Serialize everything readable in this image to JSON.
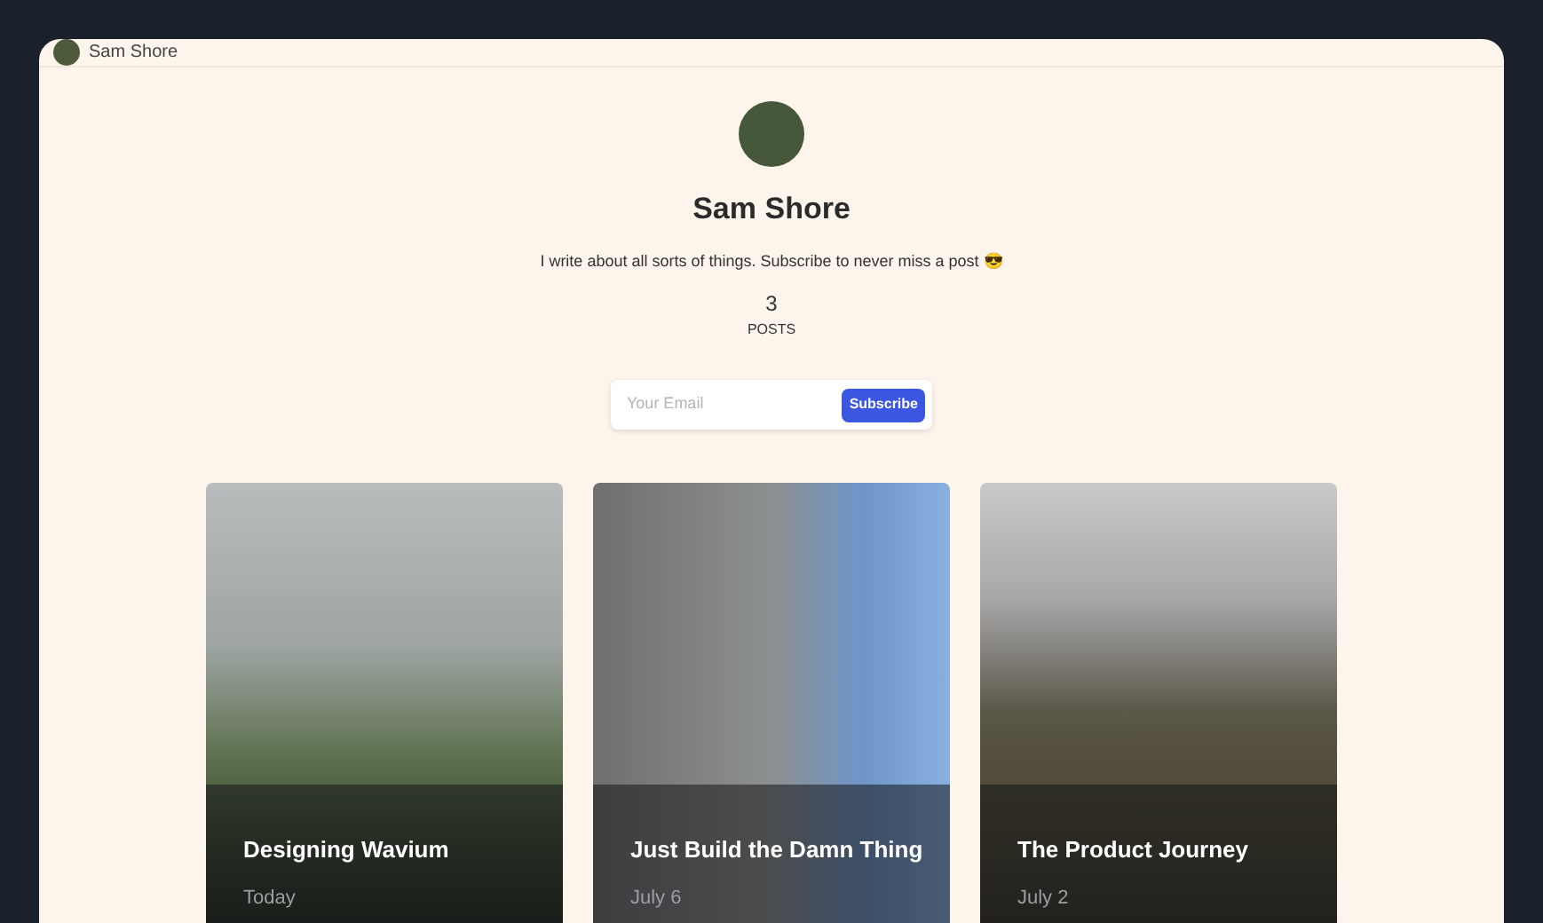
{
  "header": {
    "name": "Sam Shore"
  },
  "profile": {
    "name": "Sam Shore",
    "bio": "I write about all sorts of things. Subscribe to never miss a post 😎",
    "post_count": "3",
    "post_label": "POSTS"
  },
  "subscribe": {
    "placeholder": "Your Email",
    "button": "Subscribe"
  },
  "posts": [
    {
      "title": "Designing Wavium",
      "date": "Today"
    },
    {
      "title": "Just Build the Damn Thing",
      "date": "July 6"
    },
    {
      "title": "The Product Journey",
      "date": "July 2"
    }
  ]
}
